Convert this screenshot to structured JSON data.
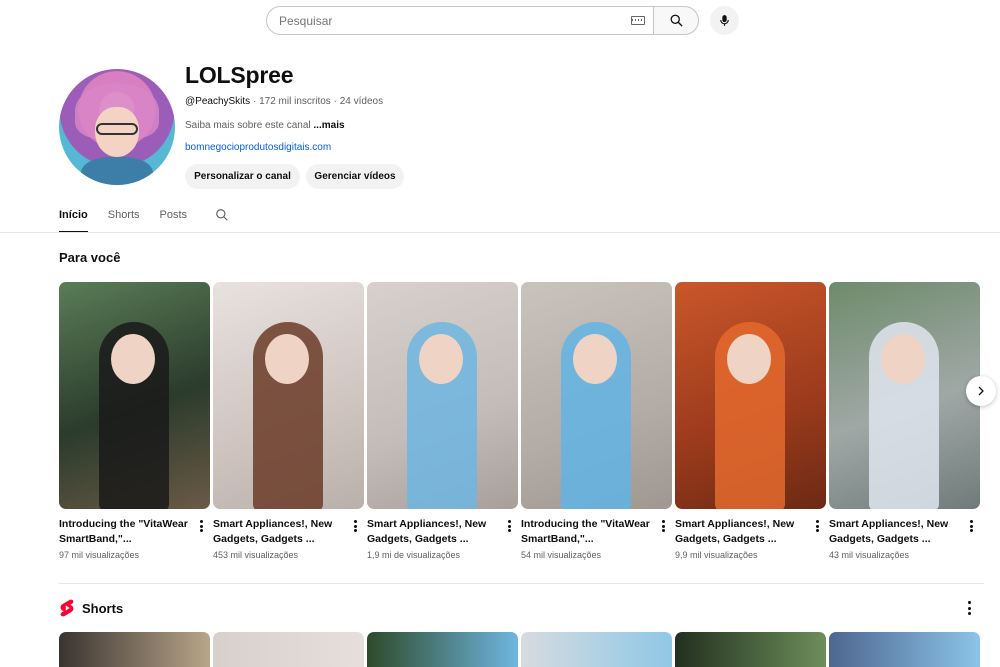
{
  "search": {
    "placeholder": "Pesquisar",
    "icons": [
      "keyboard-icon",
      "search-icon",
      "mic-icon"
    ]
  },
  "channel": {
    "name": "LOLSpree",
    "handle": "@PeachySkits",
    "subscribers": "172 mil inscritos",
    "videos_count": "24 vídeos",
    "separator": "·",
    "about": "Saiba mais sobre este canal",
    "about_more": "...mais",
    "link": "bomnegocioprodutosdigitais.com",
    "customize_label": "Personalizar o canal",
    "manage_label": "Gerenciar vídeos"
  },
  "tabs": [
    {
      "label": "Início",
      "active": true
    },
    {
      "label": "Shorts",
      "active": false
    },
    {
      "label": "Posts",
      "active": false
    }
  ],
  "for_you": {
    "title": "Para você",
    "videos": [
      {
        "title": "Introducing the \"VitaWear SmartBand,\"...",
        "views": "97 mil visualizações"
      },
      {
        "title": "Smart Appliances!, New Gadgets, Gadgets ...",
        "views": "453 mil visualizações"
      },
      {
        "title": "Smart Appliances!, New Gadgets, Gadgets ...",
        "views": "1,9 mi de visualizações"
      },
      {
        "title": "Introducing the \"VitaWear SmartBand,\"...",
        "views": "54 mil visualizações"
      },
      {
        "title": "Smart Appliances!, New Gadgets, Gadgets ...",
        "views": "9,9 mil visualizações"
      },
      {
        "title": "Smart Appliances!, New Gadgets, Gadgets ...",
        "views": "43 mil visualizações"
      }
    ]
  },
  "shorts": {
    "title": "Shorts",
    "brand_color": "#ff0033"
  }
}
